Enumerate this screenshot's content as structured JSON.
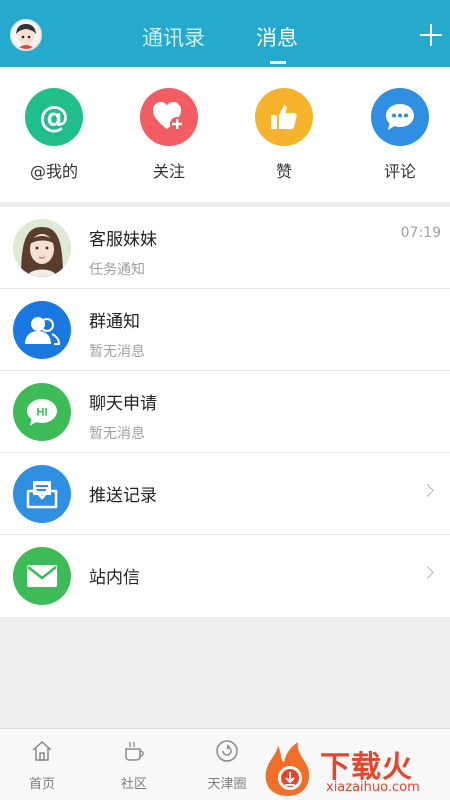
{
  "header": {
    "tabs": [
      {
        "label": "通讯录",
        "active": false
      },
      {
        "label": "消息",
        "active": true
      }
    ],
    "accent_color": "#25a9cd"
  },
  "quick_actions": [
    {
      "label": "@我的",
      "icon": "at-icon",
      "color": "#1fbe8a"
    },
    {
      "label": "关注",
      "icon": "heart-plus-icon",
      "color": "#f25c63"
    },
    {
      "label": "赞",
      "icon": "thumbs-up-icon",
      "color": "#f6b32b"
    },
    {
      "label": "评论",
      "icon": "chat-bubble-icon",
      "color": "#2e8fe3"
    }
  ],
  "messages": [
    {
      "title": "客服妹妹",
      "subtitle": "任务通知",
      "time": "07:19",
      "icon": "service-avatar"
    },
    {
      "title": "群通知",
      "subtitle": "暂无消息",
      "icon": "group-icon",
      "color": "#1a79e0"
    },
    {
      "title": "聊天申请",
      "subtitle": "暂无消息",
      "icon": "hi-bubble-icon",
      "icon_text": "HI",
      "color": "#3dbb57"
    },
    {
      "title": "推送记录",
      "icon": "inbox-icon",
      "color": "#2e8fe3"
    },
    {
      "title": "站内信",
      "icon": "envelope-icon",
      "color": "#3dbb57"
    }
  ],
  "bottom_nav": [
    {
      "label": "首页",
      "icon": "home-icon"
    },
    {
      "label": "社区",
      "icon": "cup-icon"
    },
    {
      "label": "天津圈",
      "icon": "refresh-circle-icon"
    }
  ],
  "watermark": {
    "text": "下载火",
    "url": "xiazaihuo.com"
  }
}
